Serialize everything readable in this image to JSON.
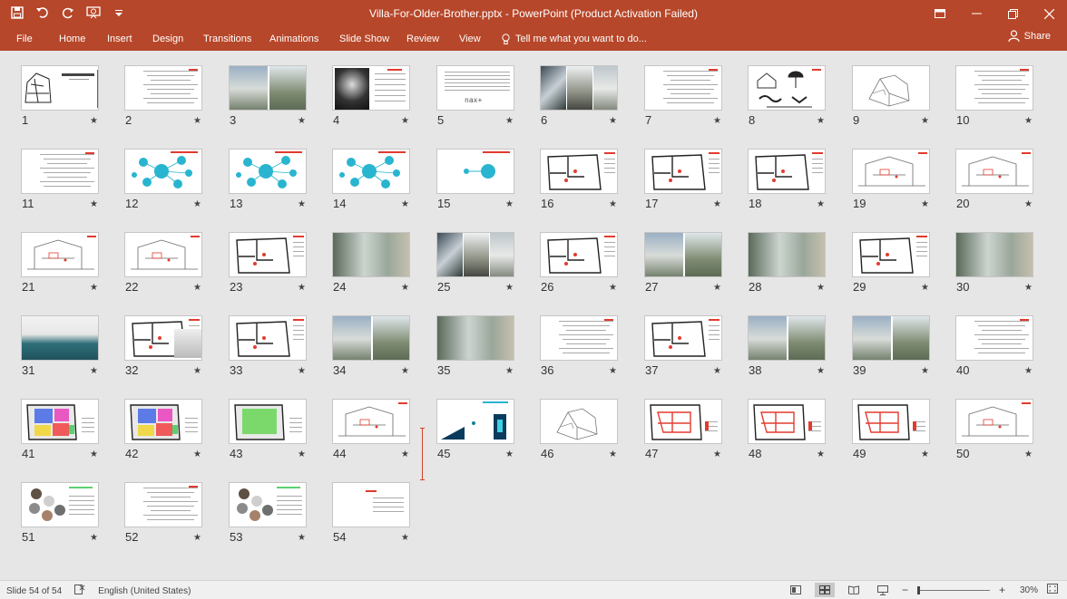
{
  "window": {
    "title": "Villa-For-Older-Brother.pptx - PowerPoint (Product Activation Failed)"
  },
  "quick_access": {
    "icons": [
      "save-icon",
      "undo-icon",
      "redo-icon",
      "start-from-beginning-icon",
      "customize-icon"
    ]
  },
  "ribbon": {
    "tabs": [
      "File",
      "Home",
      "Insert",
      "Design",
      "Transitions",
      "Animations",
      "Slide Show",
      "Review",
      "View"
    ],
    "tell_me": "Tell me what you want to do...",
    "share": "Share"
  },
  "slides": {
    "numbers": [
      "1",
      "2",
      "3",
      "4",
      "5",
      "6",
      "7",
      "8",
      "9",
      "10",
      "11",
      "12",
      "13",
      "14",
      "15",
      "16",
      "17",
      "18",
      "19",
      "20",
      "21",
      "22",
      "23",
      "24",
      "25",
      "26",
      "27",
      "28",
      "29",
      "30",
      "31",
      "32",
      "33",
      "34",
      "35",
      "36",
      "37",
      "38",
      "39",
      "40",
      "41",
      "42",
      "43",
      "44",
      "45",
      "46",
      "47",
      "48",
      "49",
      "50",
      "51",
      "52",
      "53",
      "54"
    ],
    "kinds": [
      "cover",
      "text",
      "photo2",
      "portrait",
      "logo",
      "photo3",
      "text",
      "icons",
      "sketch",
      "text",
      "text",
      "bubbles",
      "bubbles",
      "bubbles",
      "bubble1",
      "plan",
      "plan",
      "plan",
      "section",
      "section",
      "section",
      "section",
      "plan",
      "photo1",
      "photo3",
      "plan",
      "photo2",
      "photo1",
      "plan",
      "photo1",
      "pool",
      "planphoto",
      "plan",
      "photo2",
      "photo1",
      "text",
      "plan",
      "photo2",
      "photo2",
      "text",
      "colorplan",
      "colorplan",
      "greenplan",
      "section",
      "diagram",
      "sketch",
      "redplan",
      "redplan",
      "redplan",
      "section",
      "circles",
      "text",
      "circles",
      "title"
    ],
    "logo_text": "nax+"
  },
  "colors": {
    "accent": "#b7472a",
    "bubble": "#29b5cf",
    "red": "#e23b2e",
    "insert_marker": "#d04423"
  },
  "status": {
    "slide_info": "Slide 54 of 54",
    "language": "English (United States)",
    "zoom": "30%",
    "zoom_fraction": 0.3
  }
}
